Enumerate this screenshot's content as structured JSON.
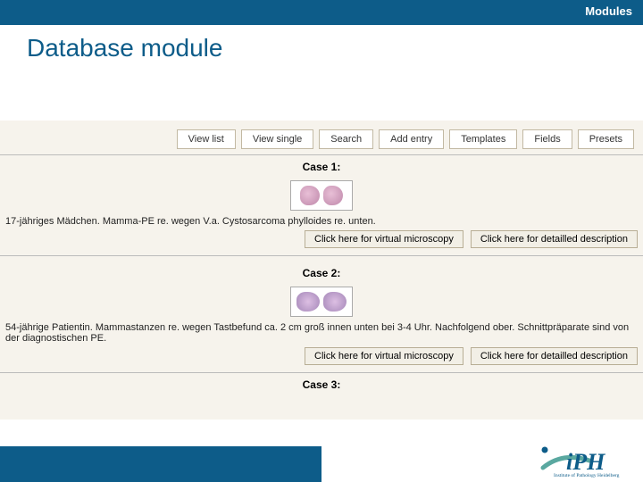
{
  "header": {
    "breadcrumb": "Modules"
  },
  "title": "Database module",
  "tabs": {
    "view_list": "View list",
    "view_single": "View single",
    "search": "Search",
    "add_entry": "Add entry",
    "templates": "Templates",
    "fields": "Fields",
    "presets": "Presets"
  },
  "cases": [
    {
      "title": "Case 1:",
      "description": "17-jähriges Mädchen. Mamma-PE re. wegen V.a. Cystosarcoma phylloides re. unten.",
      "btn_vm": "Click here for virtual microscopy",
      "btn_desc": "Click here for detailled description"
    },
    {
      "title": "Case 2:",
      "description": "54-jährige Patientin. Mammastanzen re. wegen Tastbefund ca. 2 cm groß innen unten bei 3-4 Uhr. Nachfolgend ober. Schnittpräparate sind von der diagnostischen PE.",
      "btn_vm": "Click here for virtual microscopy",
      "btn_desc": "Click here for detailled description"
    },
    {
      "title": "Case 3:"
    }
  ],
  "logo": {
    "text": "iPH",
    "subtitle": "Institute of Pathology Heidelberg"
  },
  "colors": {
    "brand": "#0d5c89",
    "panel_bg": "#f6f3ec",
    "accent_teal": "#5aa8a0"
  }
}
